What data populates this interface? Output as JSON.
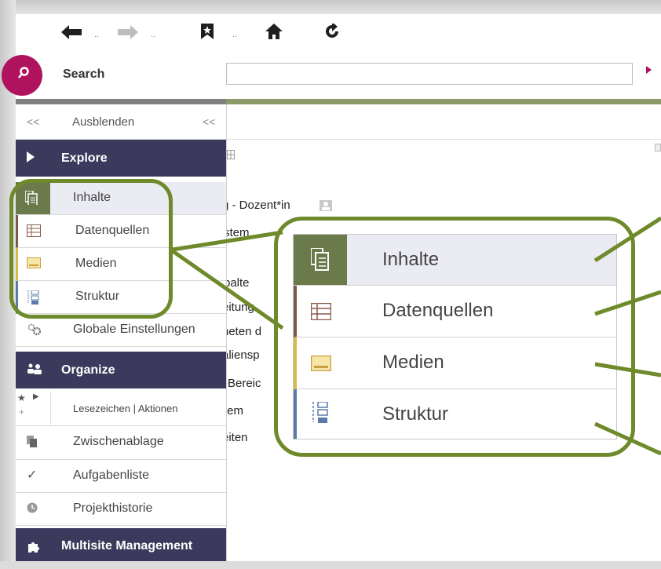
{
  "toolbar": {
    "back_dots": "..",
    "forward_dots": "..",
    "bookmark_dots": ".."
  },
  "search": {
    "label": "Search",
    "placeholder": ""
  },
  "sidebar": {
    "collapse_left": "<<",
    "hide_label": "Ausblenden",
    "collapse_right": "<<",
    "explore": "Explore",
    "items": [
      "Inhalte",
      "Datenquellen",
      "Medien",
      "Struktur",
      "Globale Einstellungen"
    ],
    "organize": "Organize",
    "bookmarks": "Lesezeichen | Aktionen",
    "organize_items": [
      "Zwischenablage",
      "Aufgabenliste",
      "Projekthistorie"
    ],
    "multisite": "Multisite Management"
  },
  "content": {
    "lines": [
      "g - Dozent*in",
      "stem",
      "palte",
      "eitung",
      "neten d",
      "aliensp",
      "-Bereic",
      "tem",
      "eiten"
    ]
  },
  "callout": {
    "items": [
      "Inhalte",
      "Datenquellen",
      "Medien",
      "Struktur"
    ]
  },
  "colors": {
    "accent": "#b0135e",
    "header": "#3c3a5c",
    "highlight": "#6e8a2a",
    "inhalte": "#6b7a4a",
    "datenquellen": "#7a5a4a",
    "medien": "#d8b84a",
    "struktur": "#5a7aaa"
  }
}
